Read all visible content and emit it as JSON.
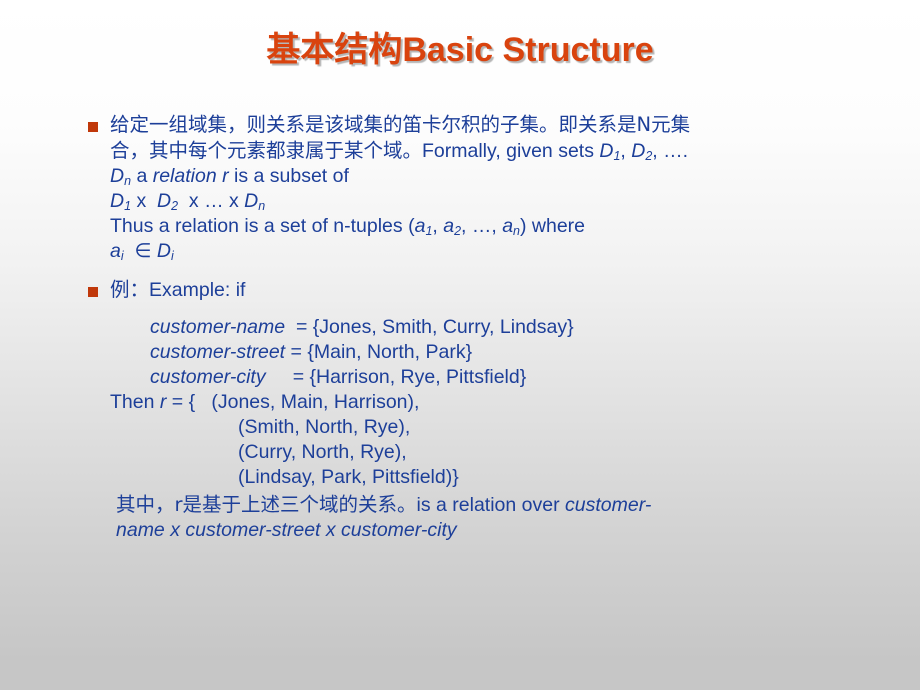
{
  "slide": {
    "title_cn": "基本结构",
    "title_en": "Basic Structure",
    "colors": {
      "title": "#d9430e",
      "body_text": "#1d3f99",
      "bullet_marker": "#c0380a",
      "background_top": "#ffffff",
      "background_bottom": "#c6c6c6"
    }
  },
  "bullets": [
    {
      "marker": "square-bullet",
      "lines": [
        {
          "id": "b1l1",
          "text": "给定一组域集，则关系是该域集的笛卡尔积的子集。即关系是N元集"
        },
        {
          "id": "b1l2_cn",
          "text": "合，其中每个元素都隶属于某个域。"
        },
        {
          "id": "b1l2_en",
          "text": "Formally, given sets "
        },
        {
          "id": "b1l2_d1",
          "text": "D"
        },
        {
          "id": "b1l2_sub1",
          "text": "1"
        },
        {
          "id": "b1l2_sep",
          "text": ", "
        },
        {
          "id": "b1l2_d2",
          "text": "D"
        },
        {
          "id": "b1l2_sub2",
          "text": "2"
        },
        {
          "id": "b1l2_tail",
          "text": ", …."
        },
        {
          "id": "b1l3_d",
          "text": "D"
        },
        {
          "id": "b1l3_subn",
          "text": "n"
        },
        {
          "id": "b1l3_a",
          "text": " a "
        },
        {
          "id": "b1l3_rel",
          "text": "relation r"
        },
        {
          "id": "b1l3_rest",
          "text": " is a subset of"
        },
        {
          "id": "b1l4_d1",
          "text": "D"
        },
        {
          "id": "b1l4_s1",
          "text": "1"
        },
        {
          "id": "b1l4_x1",
          "text": " x  "
        },
        {
          "id": "b1l4_d2",
          "text": "D"
        },
        {
          "id": "b1l4_s2",
          "text": "2"
        },
        {
          "id": "b1l4_x2",
          "text": "  x … x "
        },
        {
          "id": "b1l4_dn",
          "text": "D"
        },
        {
          "id": "b1l4_sn",
          "text": "n"
        },
        {
          "id": "b1l5_pre",
          "text": "Thus a relation is a set of n-tuples ("
        },
        {
          "id": "b1l5_a1",
          "text": "a"
        },
        {
          "id": "b1l5_s1",
          "text": "1"
        },
        {
          "id": "b1l5_c1",
          "text": ", "
        },
        {
          "id": "b1l5_a2",
          "text": "a"
        },
        {
          "id": "b1l5_s2",
          "text": "2"
        },
        {
          "id": "b1l5_c2",
          "text": ", …, "
        },
        {
          "id": "b1l5_an",
          "text": "a"
        },
        {
          "id": "b1l5_sn",
          "text": "n"
        },
        {
          "id": "b1l5_tail",
          "text": ") where"
        },
        {
          "id": "b1l6_a",
          "text": "a"
        },
        {
          "id": "b1l6_si",
          "text": "i"
        },
        {
          "id": "b1l6_in",
          "text": "  ∈ "
        },
        {
          "id": "b1l6_d",
          "text": "D"
        },
        {
          "id": "b1l6_sdi",
          "text": "i"
        }
      ]
    },
    {
      "marker": "square-bullet",
      "lines": [
        {
          "id": "b2l1_cn",
          "text": "例："
        },
        {
          "id": "b2l1_en",
          "text": "Example:  if"
        }
      ]
    }
  ],
  "example": {
    "domains": [
      {
        "name": "customer-name",
        "gap": "  ",
        "eq": "= {Jones, Smith, Curry, Lindsay}"
      },
      {
        "name": "customer-street",
        "gap": " ",
        "eq": "= {Main, North, Park}"
      },
      {
        "name": "customer-city",
        "gap": "     ",
        "eq": "= {Harrison, Rye, Pittsfield}"
      }
    ],
    "then_prefix": "Then ",
    "then_r": "r",
    "then_open": " = {   ",
    "tuples": [
      "(Jones, Main, Harrison),",
      "(Smith, North, Rye),",
      "(Curry, North, Rye),",
      "(Lindsay, Park, Pittsfield)}"
    ],
    "closing_cn": " 其中，r是基于上述三个域的关系。",
    "closing_en": "is a relation over ",
    "closing_italic_1": "customer-",
    "closing_italic_2": "name x customer-street x customer-city"
  }
}
